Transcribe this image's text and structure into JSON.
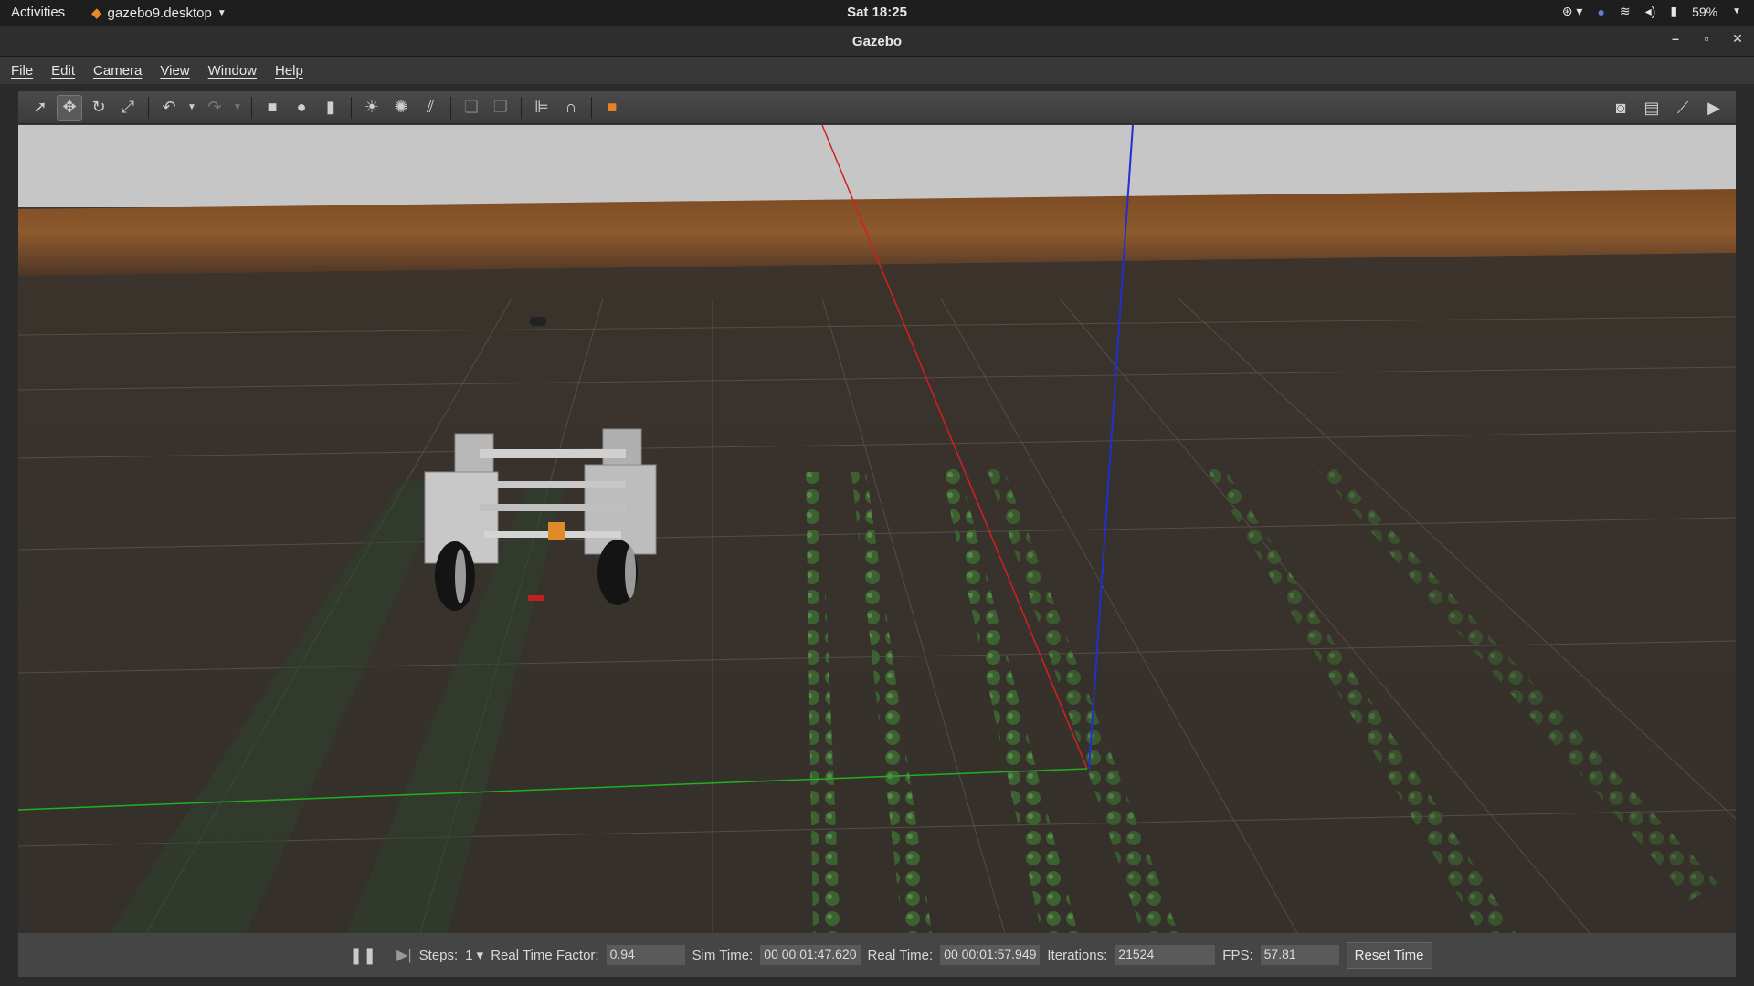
{
  "topbar": {
    "activities": "Activities",
    "app_name": "gazebo9.desktop",
    "clock": "Sat 18:25",
    "battery": "59%"
  },
  "window": {
    "title": "Gazebo"
  },
  "menu": [
    "File",
    "Edit",
    "Camera",
    "View",
    "Window",
    "Help"
  ],
  "toolbar": {
    "tools": [
      "select-icon",
      "translate-icon",
      "rotate-icon",
      "scale-icon",
      "undo-icon",
      "redo-icon",
      "box-icon",
      "sphere-icon",
      "cylinder-icon",
      "point-light-icon",
      "spot-light-icon",
      "directional-light-icon",
      "copy-icon",
      "paste-icon",
      "align-icon",
      "snap-icon",
      "view-angle-icon"
    ],
    "right_tools": [
      "screenshot-icon",
      "log-icon",
      "plot-icon",
      "record-video-icon"
    ]
  },
  "status": {
    "steps_label": "Steps:",
    "steps_value": "1",
    "rtf_label": "Real Time Factor:",
    "rtf_value": "0.94",
    "sim_time_label": "Sim Time:",
    "sim_time_value": "00 00:01:47.620",
    "real_time_label": "Real Time:",
    "real_time_value": "00 00:01:57.949",
    "iterations_label": "Iterations:",
    "iterations_value": "21524",
    "fps_label": "FPS:",
    "fps_value": "57.81",
    "reset_label": "Reset Time"
  },
  "colors": {
    "sky": "#c8c8c8",
    "horizon": "#8a5a2c",
    "ground": "#3a3430",
    "plant": "#3f6a2e",
    "axis_x": "#d42020",
    "axis_y": "#20b020",
    "axis_z": "#2030d0"
  }
}
